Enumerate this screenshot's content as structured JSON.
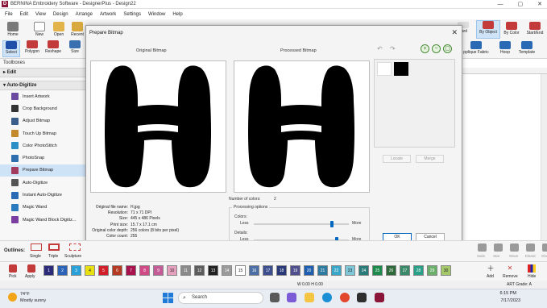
{
  "window": {
    "title": "BERNINA Embroidery Software - DesignerPlus - Design22",
    "app_icon_letter": "D",
    "controls": [
      "—",
      "▢",
      "✕"
    ]
  },
  "menu": [
    "File",
    "Edit",
    "View",
    "Design",
    "Arrange",
    "Artwork",
    "Settings",
    "Window",
    "Help"
  ],
  "ribbon": {
    "home": "Home",
    "new": "New",
    "open": "Open",
    "recent": "Recent",
    "select": "Select",
    "polygon": "Polygon",
    "reshape": "Reshape",
    "size": "Size",
    "board": "oard",
    "by_object": "By Object",
    "by_color": "By Color",
    "start_end": "Start/End",
    "applique_fabric": "pplique Fabric",
    "hoop": "Hoop",
    "template": "Template"
  },
  "toolbox": {
    "heading": "Toolboxes",
    "sections": [
      "Edit",
      "Auto-Digitize"
    ],
    "items": [
      {
        "label": "Insert Artwork",
        "icon": "insert-artwork-icon",
        "color": "#6b4aa0"
      },
      {
        "label": "Crop Background",
        "icon": "crop-icon",
        "color": "#333333"
      },
      {
        "label": "Adjust Bitmap",
        "icon": "adjust-bitmap-icon",
        "color": "#3a5f8a"
      },
      {
        "label": "Touch Up Bitmap",
        "icon": "touch-up-icon",
        "color": "#c28a2a"
      },
      {
        "label": "Color PhotoStitch",
        "icon": "color-photostitch-icon",
        "color": "#2c8ec6"
      },
      {
        "label": "PhotoSnap",
        "icon": "photosnap-icon",
        "color": "#2f6fb0"
      },
      {
        "label": "Prepare Bitmap",
        "icon": "prepare-bitmap-icon",
        "color": "#a33b5e"
      },
      {
        "label": "Auto-Digitize",
        "icon": "auto-digitize-icon",
        "color": "#555555"
      },
      {
        "label": "Instant Auto-Digitize",
        "icon": "instant-auto-digitize-icon",
        "color": "#2a6ab5"
      },
      {
        "label": "Magic Wand",
        "icon": "magic-wand-icon",
        "color": "#2d7bbf"
      },
      {
        "label": "Magic Wand Block Digitiz...",
        "icon": "magic-wand-block-icon",
        "color": "#7a3da0"
      }
    ]
  },
  "dialog": {
    "title": "Prepare Bitmap",
    "original_label": "Original Bitmap",
    "processed_label": "Processed Bitmap",
    "file_info": [
      {
        "key": "Original file name:",
        "value": "H.jpg"
      },
      {
        "key": "Resolution:",
        "value": "71 x 71 DPI"
      },
      {
        "key": "Size:",
        "value": "445 x 486 Pixels"
      },
      {
        "key": "Print size:",
        "value": "15.7 x 17.1 cm"
      },
      {
        "key": "Original color depth:",
        "value": "256 colors (8 bits per pixel)"
      },
      {
        "key": "Color count:",
        "value": "255"
      }
    ],
    "num_colors_label": "Number of colors:",
    "num_colors_value": "2",
    "processing_options": "Processing options",
    "colors_label": "Colors:",
    "details_label": "Details:",
    "less": "Less",
    "more": "More",
    "colors_slider": 0.82,
    "details_slider": 0.87,
    "locate": "Locate",
    "merge": "Merge",
    "ok": "OK",
    "cancel": "Cancel",
    "palette": [
      "#ffffff",
      "#000000"
    ]
  },
  "outlines": {
    "label": "Outlines:",
    "single": "Single",
    "triple": "Triple",
    "sculpture": "Sculpture",
    "right_items": [
      "Satin",
      "Star",
      "Wave",
      "Elastic",
      "Globe"
    ]
  },
  "colorbar": {
    "pick": "Pick",
    "apply": "Apply",
    "add": "Add",
    "remove": "Remove",
    "hide": "Hide",
    "swatches": [
      {
        "n": "1",
        "c": "#2b2b7a"
      },
      {
        "n": "2",
        "c": "#2a63b8"
      },
      {
        "n": "3",
        "c": "#2aa0d8"
      },
      {
        "n": "4",
        "c": "#e8e011"
      },
      {
        "n": "5",
        "c": "#d11f2a"
      },
      {
        "n": "6",
        "c": "#b43a24"
      },
      {
        "n": "7",
        "c": "#a8124d"
      },
      {
        "n": "8",
        "c": "#d14a88"
      },
      {
        "n": "9",
        "c": "#c35c97"
      },
      {
        "n": "10",
        "c": "#e5a0bd"
      },
      {
        "n": "11",
        "c": "#8a8a8a"
      },
      {
        "n": "12",
        "c": "#5d5d5d"
      },
      {
        "n": "13",
        "c": "#222222"
      },
      {
        "n": "14",
        "c": "#9a9a9a"
      },
      {
        "n": "15",
        "c": "#ffffff"
      },
      {
        "n": "16",
        "c": "#4b6fa4"
      },
      {
        "n": "17",
        "c": "#3d4f8e"
      },
      {
        "n": "18",
        "c": "#2a3a78"
      },
      {
        "n": "19",
        "c": "#4f4f8e"
      },
      {
        "n": "20",
        "c": "#1f5fb0"
      },
      {
        "n": "21",
        "c": "#2f7aa0"
      },
      {
        "n": "22",
        "c": "#3aa7c8"
      },
      {
        "n": "23",
        "c": "#7fc7d8"
      },
      {
        "n": "24",
        "c": "#2b7a7a"
      },
      {
        "n": "25",
        "c": "#1b8a4a"
      },
      {
        "n": "26",
        "c": "#2f6a3a"
      },
      {
        "n": "27",
        "c": "#3a8a6a"
      },
      {
        "n": "28",
        "c": "#2aa08a"
      },
      {
        "n": "29",
        "c": "#6ab06a"
      },
      {
        "n": "30",
        "c": "#a4c86a"
      }
    ]
  },
  "status": {
    "coords": "W 0.00 H 0.00",
    "right": "ART Grade: A"
  },
  "taskbar": {
    "weather_temp": "74°F",
    "weather_desc": "Mostly sunny",
    "search": "Search",
    "time": "6:15 PM",
    "date": "7/17/2023"
  }
}
